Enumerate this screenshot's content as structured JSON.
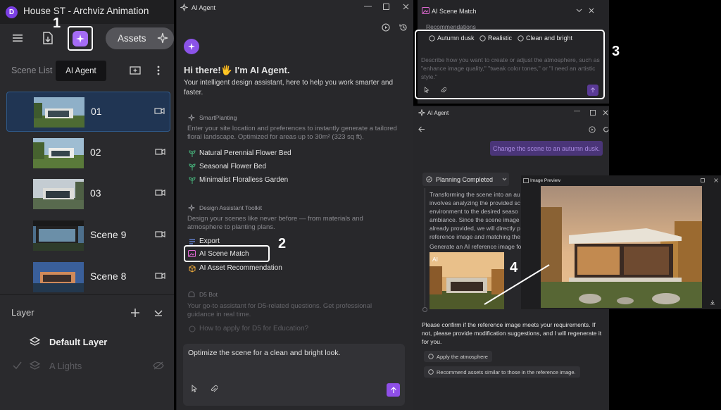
{
  "app": {
    "title": "House ST - Archviz Animation",
    "logo_letter": "D"
  },
  "toolbar": {
    "assets_label": "Assets",
    "tooltip": "AI Agent"
  },
  "scene_list": {
    "label": "Scene List",
    "items": [
      {
        "name": "01",
        "selected": true
      },
      {
        "name": "02",
        "selected": false
      },
      {
        "name": "03",
        "selected": false
      },
      {
        "name": "Scene 9",
        "selected": false
      },
      {
        "name": "Scene 8",
        "selected": false
      }
    ]
  },
  "layer": {
    "label": "Layer",
    "rows": [
      {
        "name": "Default Layer"
      },
      {
        "name": "A Lights"
      }
    ]
  },
  "ai_agent_panel": {
    "title": "AI Agent",
    "greeting": "Hi there!🖐 I'm AI Agent.",
    "subtitle": "Your intelligent design assistant, here to help you work smarter and faster.",
    "smart_planting": {
      "heading": "SmartPlanting",
      "description": "Enter your site location and preferences to instantly generate a tailored floral landscape. Optimized for areas up to 30m² (323 sq ft).",
      "items": [
        "Natural Perennial Flower Bed",
        "Seasonal Flower Bed",
        "Minimalist Floralless Garden"
      ]
    },
    "toolkit": {
      "heading": "Design Assistant Toolkit",
      "description": "Design your scenes like never before — from materials and atmosphere to planting plans.",
      "items": [
        "Export",
        "AI Scene Match",
        "AI Asset Recommendation"
      ]
    },
    "bot": {
      "heading": "D5 Bot",
      "description": "Your go-to assistant for D5-related questions. Get professional guidance in real time.",
      "question": "How to apply for D5 for Education?"
    },
    "composer_text": "Optimize the scene for a clean and bright look."
  },
  "scene_match": {
    "title": "AI Scene Match",
    "recommendations_label": "Recommendations",
    "chips": [
      "Autumn dusk",
      "Realistic",
      "Clean and bright"
    ],
    "placeholder": "Describe how you want to create or adjust the atmosphere, such as \"enhance image quality,\" \"tweak color tones,\" or \"I need an artistic style.\""
  },
  "agent_chat": {
    "title": "AI Agent",
    "user_message": "Change the scene to an autumn dusk.",
    "planning_label": "Planning Completed",
    "plan_text": "Transforming the scene into an au involves analyzing the provided sc environment to the desired seaso ambiance. Since the scene image already provided, we will directly p reference image and matching the",
    "generate_text": "Generate an AI reference image fo",
    "thumb_label": "AI",
    "confirm_text": "Please confirm if the reference image meets your requirements. If not, please provide modification suggestions, and I will regenerate it for you.",
    "apply_btn": "Apply the atmosphere",
    "recommend_btn": "Recommend assets similar to those in the reference image."
  },
  "image_preview": {
    "title": "Image Preview"
  },
  "callouts": [
    "1",
    "2",
    "3",
    "4"
  ],
  "colors": {
    "accent": "#8f4fe8",
    "selection": "#203553",
    "panel": "#28282b"
  }
}
